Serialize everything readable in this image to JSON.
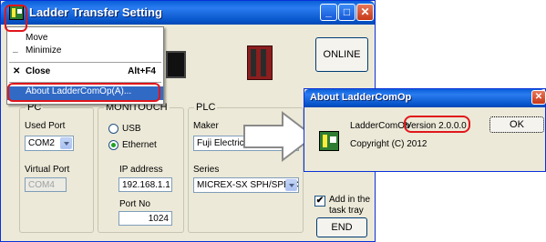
{
  "main_window": {
    "title": "Ladder Transfer Setting",
    "online_button": "ONLINE",
    "end_button": "END",
    "system_menu": {
      "items": [
        {
          "label": "Move",
          "shortcut": ""
        },
        {
          "label": "Minimize",
          "shortcut": ""
        },
        {
          "label": "Close",
          "shortcut": "Alt+F4"
        },
        {
          "label": "About LadderComOp(A)...",
          "shortcut": ""
        }
      ]
    },
    "pc": {
      "group_label": "PC",
      "used_port_label": "Used Port",
      "used_port_value": "COM2",
      "virtual_port_label": "Virtual Port",
      "virtual_port_value": "COM4"
    },
    "monitouch": {
      "group_label": "MONITOUCH",
      "usb_label": "USB",
      "ethernet_label": "Ethernet",
      "selected": "Ethernet",
      "ip_label": "IP address",
      "ip_value": "192.168.1.1",
      "port_label": "Port No",
      "port_value": "1024"
    },
    "plc": {
      "group_label": "PLC",
      "maker_label": "Maker",
      "maker_value": "Fuji Electric",
      "series_label": "Series",
      "series_value": "MICREX-SX SPH/SPB CF"
    },
    "tasktray": {
      "checked": true,
      "label_line1": "Add in the",
      "label_line2": "task tray"
    }
  },
  "about_dialog": {
    "title": "About LadderComOp",
    "product": "LadderComOp",
    "version": "Version 2.0.0.0",
    "copyright": "Copyright (C) 2012",
    "ok_button": "OK"
  },
  "colors": {
    "highlight": "#316ac5",
    "annotation_ring": "#e0161b",
    "titlebar": "#0a5fd8"
  }
}
